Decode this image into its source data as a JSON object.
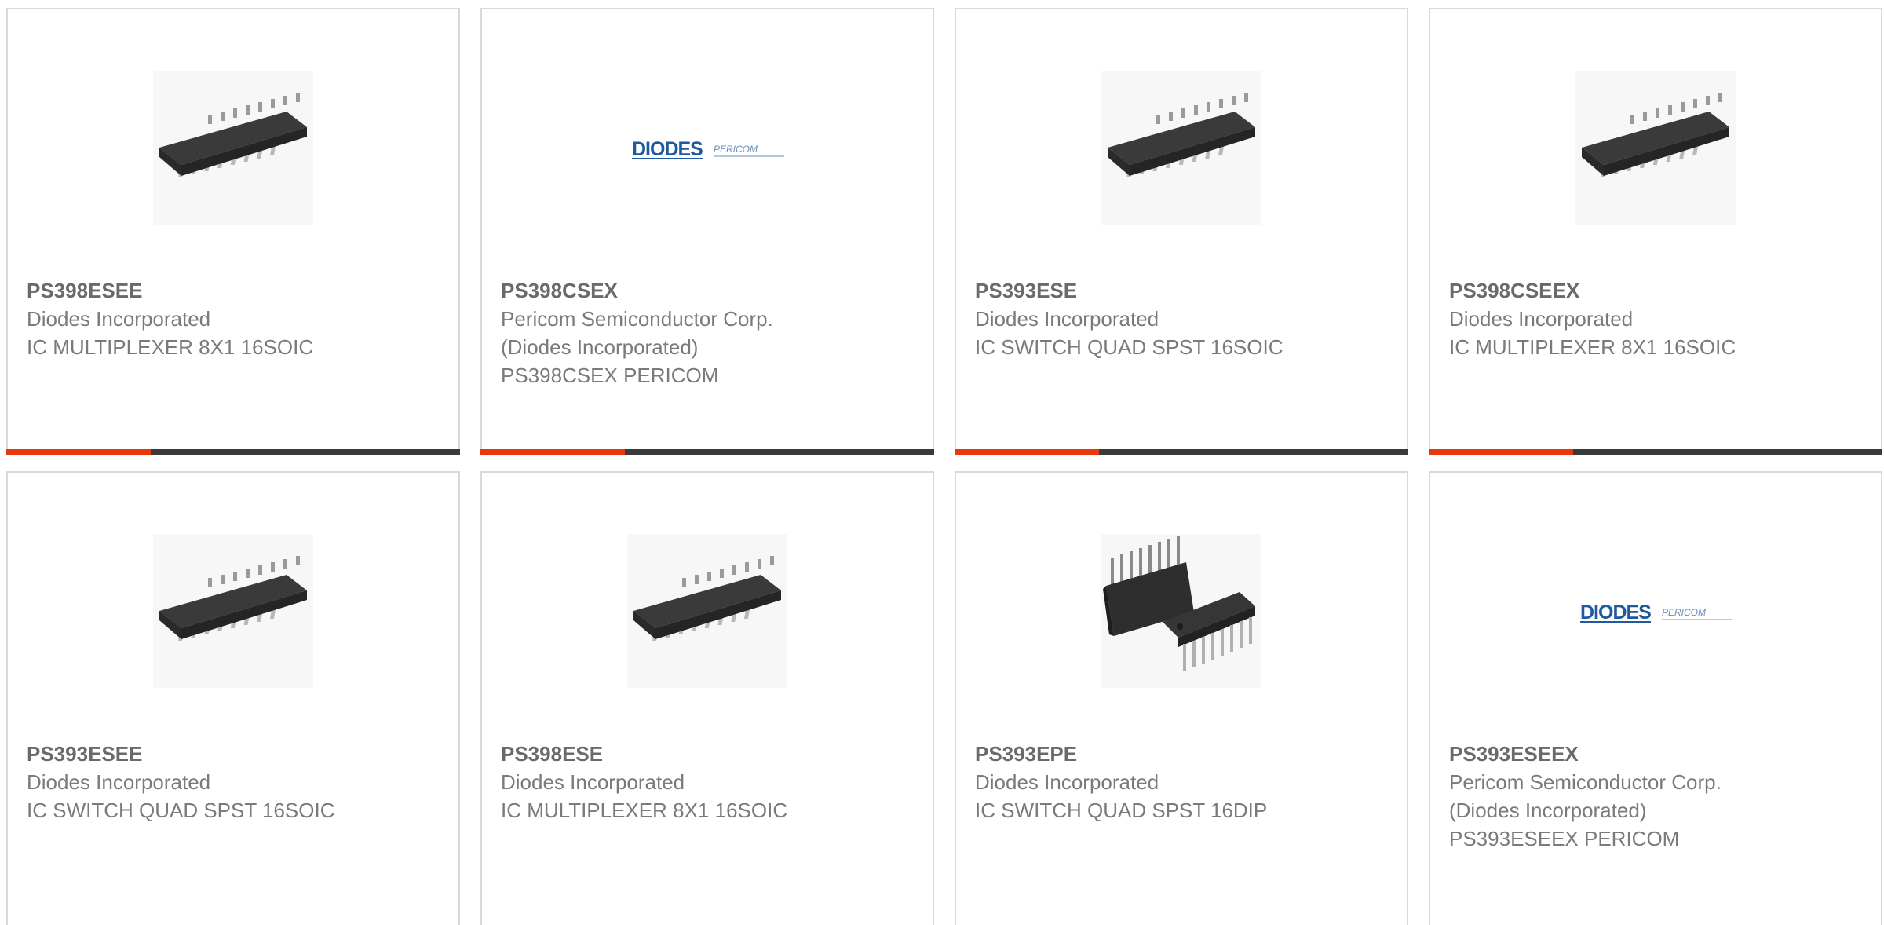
{
  "colors": {
    "accent": "#e8380d",
    "bar": "#3a3a3a",
    "border": "#d9d9d9",
    "text": "#7a7a7a"
  },
  "cards": [
    {
      "part": "PS398ESEE",
      "lines": [
        "Diodes Incorporated",
        "IC MULTIPLEXER 8X1 16SOIC"
      ],
      "image": "soic-16-chip-icon"
    },
    {
      "part": "PS398CSEX",
      "lines": [
        "Pericom Semiconductor Corp.",
        "(Diodes Incorporated)",
        "PS398CSEX PERICOM"
      ],
      "image": "diodes-pericom-logo",
      "logo_text": [
        "DIODES",
        "PERICOM"
      ]
    },
    {
      "part": "PS393ESE",
      "lines": [
        "Diodes Incorporated",
        "IC SWITCH QUAD SPST 16SOIC"
      ],
      "image": "soic-16-chip-icon"
    },
    {
      "part": "PS398CSEEX",
      "lines": [
        "Diodes Incorporated",
        "IC MULTIPLEXER 8X1 16SOIC"
      ],
      "image": "soic-16-chip-icon"
    },
    {
      "part": "PS393ESEE",
      "lines": [
        "Diodes Incorporated",
        "IC SWITCH QUAD SPST 16SOIC"
      ],
      "image": "soic-16-chip-icon"
    },
    {
      "part": "PS398ESE",
      "lines": [
        "Diodes Incorporated",
        "IC MULTIPLEXER 8X1 16SOIC"
      ],
      "image": "soic-16-chip-icon"
    },
    {
      "part": "PS393EPE",
      "lines": [
        "Diodes Incorporated",
        "IC SWITCH QUAD SPST 16DIP"
      ],
      "image": "dip-16-chip-icon"
    },
    {
      "part": "PS393ESEEX",
      "lines": [
        "Pericom Semiconductor Corp.",
        "(Diodes Incorporated)",
        "PS393ESEEX PERICOM"
      ],
      "image": "diodes-pericom-logo",
      "logo_text": [
        "DIODES",
        "PERICOM"
      ]
    }
  ]
}
